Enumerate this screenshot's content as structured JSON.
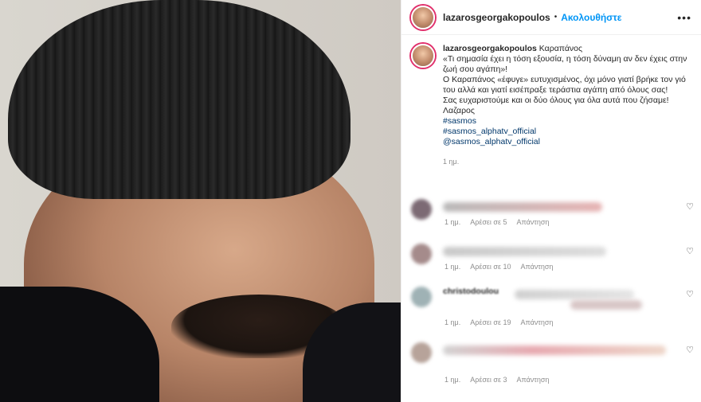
{
  "header": {
    "username": "lazarosgeorgakopoulos",
    "separator": "•",
    "follow_label": "Ακολουθήστε",
    "more_icon": "more-horizontal-icon"
  },
  "caption": {
    "username": "lazarosgeorgakopoulos",
    "title": "Καραπάνος",
    "lines": [
      "«Τι σημασία έχει η τόση εξουσία, η τόση δύναμη αν δεν έχεις στην ζωή σου αγάπη»!",
      "Ο Καραπάνος «έφυγε» ευτυχισμένος, όχι μόνο γιατί βρήκε τον γιό του αλλά και γιατί εισέπραξε τεράστια αγάπη από όλους σας!",
      "Σας ευχαριστούμε και οι δύο όλους για όλα αυτά που ζήσαμε!",
      "Λαζαρος"
    ],
    "tags": [
      "#sasmos",
      "#sasmos_alphatv_official",
      "@sasmos_alphatv_official"
    ],
    "time": "1 ημ."
  },
  "comments": [
    {
      "time": "1 ημ.",
      "likes": "Αρέσει σε 5",
      "reply": "Απάντηση",
      "name": ""
    },
    {
      "time": "1 ημ.",
      "likes": "Αρέσει σε 10",
      "reply": "Απάντηση",
      "name": ""
    },
    {
      "time": "1 ημ.",
      "likes": "Αρέσει σε 19",
      "reply": "Απάντηση",
      "name": "christodoulou"
    },
    {
      "time": "1 ημ.",
      "likes": "Αρέσει σε 3",
      "reply": "Απάντηση",
      "name": ""
    }
  ],
  "icons": {
    "heart": "heart-icon"
  },
  "colors": {
    "follow": "#0095f6",
    "link": "#00376b",
    "meta": "#8e8e8e"
  }
}
